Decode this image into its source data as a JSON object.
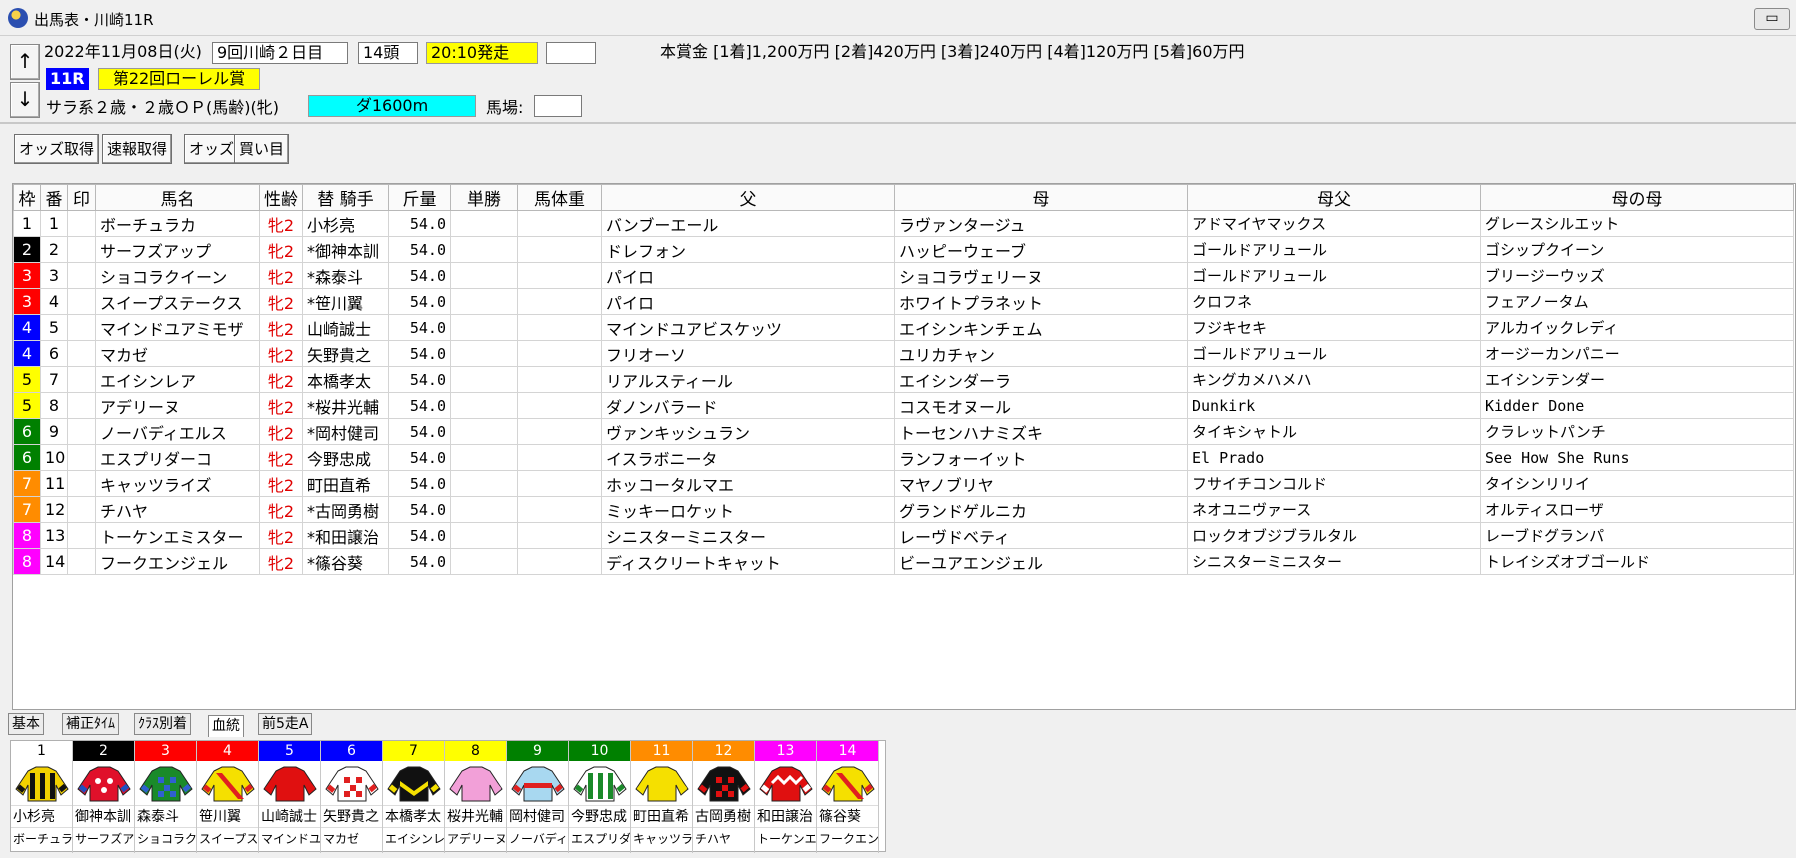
{
  "window": {
    "title": "出馬表・川崎11R",
    "restore_label": "▭"
  },
  "header": {
    "up_label": "↑",
    "down_label": "↓",
    "date": "2022年11月08日(火)",
    "meeting": "9回川崎２日目",
    "runners": "14頭",
    "post_time": "20:10発走",
    "blank_box": "",
    "prize": "本賞金 [1着]1,200万円 [2着]420万円 [3着]240万円 [4着]120万円 [5着]60万円",
    "race_no": "11R",
    "race_name": "第22回ローレル賞",
    "conditions": "サラ系２歳・２歳ＯＰ(馬齢)(牝)",
    "course": "ダ1600m",
    "baba_label": "馬場:",
    "baba_value": ""
  },
  "toolbar": {
    "odds_fetch": "オッズ取得",
    "sokuho_fetch": "速報取得",
    "odds": "オッズ",
    "kaime": "買い目"
  },
  "table": {
    "headers": [
      "枠",
      "番",
      "印",
      "馬名",
      "性齢",
      "替 騎手",
      "斤量",
      "単勝",
      "馬体重",
      "父",
      "母",
      "母父",
      "母の母"
    ],
    "rows": [
      {
        "waku": "1",
        "ban": "1",
        "mark": "",
        "name": "ボーチュラカ",
        "sex": "牝2",
        "jockey": " 小杉亮",
        "weight": "54.0",
        "odds": "",
        "bw": "",
        "sire": "バンブーエール",
        "dam": "ラヴァンタージュ",
        "damsire": "アドマイヤマックス",
        "damdam": "グレースシルエット"
      },
      {
        "waku": "2",
        "ban": "2",
        "mark": "",
        "name": "サーフズアップ",
        "sex": "牝2",
        "jockey": "*御神本訓",
        "weight": "54.0",
        "odds": "",
        "bw": "",
        "sire": "ドレフォン",
        "dam": "ハッピーウェーブ",
        "damsire": "ゴールドアリュール",
        "damdam": "ゴシップクイーン"
      },
      {
        "waku": "3",
        "ban": "3",
        "mark": "",
        "name": "ショコラクイーン",
        "sex": "牝2",
        "jockey": "*森泰斗",
        "weight": "54.0",
        "odds": "",
        "bw": "",
        "sire": "パイロ",
        "dam": "ショコラヴェリーヌ",
        "damsire": "ゴールドアリュール",
        "damdam": "ブリージーウッズ"
      },
      {
        "waku": "3",
        "ban": "4",
        "mark": "",
        "name": "スイープステークス",
        "sex": "牝2",
        "jockey": "*笹川翼",
        "weight": "54.0",
        "odds": "",
        "bw": "",
        "sire": "パイロ",
        "dam": "ホワイトプラネット",
        "damsire": "クロフネ",
        "damdam": "フェアノータム"
      },
      {
        "waku": "4",
        "ban": "5",
        "mark": "",
        "name": "マインドユアミモザ",
        "sex": "牝2",
        "jockey": " 山崎誠士",
        "weight": "54.0",
        "odds": "",
        "bw": "",
        "sire": "マインドユアビスケッツ",
        "dam": "エイシンキンチェム",
        "damsire": "フジキセキ",
        "damdam": "アルカイックレディ"
      },
      {
        "waku": "4",
        "ban": "6",
        "mark": "",
        "name": "マカゼ",
        "sex": "牝2",
        "jockey": " 矢野貴之",
        "weight": "54.0",
        "odds": "",
        "bw": "",
        "sire": "フリオーソ",
        "dam": "ユリカチャン",
        "damsire": "ゴールドアリュール",
        "damdam": "オージーカンパニー"
      },
      {
        "waku": "5",
        "ban": "7",
        "mark": "",
        "name": "エイシンレア",
        "sex": "牝2",
        "jockey": " 本橋孝太",
        "weight": "54.0",
        "odds": "",
        "bw": "",
        "sire": "リアルスティール",
        "dam": "エイシンダーラ",
        "damsire": "キングカメハメハ",
        "damdam": "エイシンテンダー"
      },
      {
        "waku": "5",
        "ban": "8",
        "mark": "",
        "name": "アデリーヌ",
        "sex": "牝2",
        "jockey": "*桜井光輔",
        "weight": "54.0",
        "odds": "",
        "bw": "",
        "sire": "ダノンバラード",
        "dam": "コスモオヌール",
        "damsire": "Dunkirk",
        "damdam": "Kidder Done"
      },
      {
        "waku": "6",
        "ban": "9",
        "mark": "",
        "name": "ノーバディエルス",
        "sex": "牝2",
        "jockey": "*岡村健司",
        "weight": "54.0",
        "odds": "",
        "bw": "",
        "sire": "ヴァンキッシュラン",
        "dam": "トーセンハナミズキ",
        "damsire": "タイキシャトル",
        "damdam": "クラレットパンチ"
      },
      {
        "waku": "6",
        "ban": "10",
        "mark": "",
        "name": "エスプリダーコ",
        "sex": "牝2",
        "jockey": " 今野忠成",
        "weight": "54.0",
        "odds": "",
        "bw": "",
        "sire": "イスラボニータ",
        "dam": "ランフォーイット",
        "damsire": "El Prado",
        "damdam": "See How She Runs"
      },
      {
        "waku": "7",
        "ban": "11",
        "mark": "",
        "name": "キャッツライズ",
        "sex": "牝2",
        "jockey": " 町田直希",
        "weight": "54.0",
        "odds": "",
        "bw": "",
        "sire": "ホッコータルマエ",
        "dam": "マヤノブリヤ",
        "damsire": "フサイチコンコルド",
        "damdam": "タイシンリリイ"
      },
      {
        "waku": "7",
        "ban": "12",
        "mark": "",
        "name": "チハヤ",
        "sex": "牝2",
        "jockey": "*古岡勇樹",
        "weight": "54.0",
        "odds": "",
        "bw": "",
        "sire": "ミッキーロケット",
        "dam": "グランドゲルニカ",
        "damsire": "ネオユニヴァース",
        "damdam": "オルティスローザ"
      },
      {
        "waku": "8",
        "ban": "13",
        "mark": "",
        "name": "トーケンエミスター",
        "sex": "牝2",
        "jockey": "*和田譲治",
        "weight": "54.0",
        "odds": "",
        "bw": "",
        "sire": "シニスターミニスター",
        "dam": "レーヴドベティ",
        "damsire": "ロックオブジブラルタル",
        "damdam": "レーブドグランパ"
      },
      {
        "waku": "8",
        "ban": "14",
        "mark": "",
        "name": "フークエンジェル",
        "sex": "牝2",
        "jockey": "*篠谷葵",
        "weight": "54.0",
        "odds": "",
        "bw": "",
        "sire": "ディスクリートキャット",
        "dam": "ビーユアエンジェル",
        "damsire": "シニスターミニスター",
        "damdam": "トレイシズオブゴールド"
      }
    ]
  },
  "tabs": [
    "基本",
    "補正ﾀｲﾑ",
    "ｸﾗｽ別着",
    "血統",
    "前5走A"
  ],
  "active_tab": "血統",
  "waku_colors": {
    "1": {
      "bg": "#ffffff",
      "fg": "#000000"
    },
    "2": {
      "bg": "#000000",
      "fg": "#ffffff"
    },
    "3": {
      "bg": "#ff0000",
      "fg": "#ffffff"
    },
    "4": {
      "bg": "#0000ff",
      "fg": "#ffffff"
    },
    "5": {
      "bg": "#ffff00",
      "fg": "#000000"
    },
    "6": {
      "bg": "#008000",
      "fg": "#ffffff"
    },
    "7": {
      "bg": "#ff8c00",
      "fg": "#ffffff"
    },
    "8": {
      "bg": "#ff00ff",
      "fg": "#ffffff"
    }
  },
  "silks": [
    {
      "num": "1",
      "jockey": "小杉亮",
      "horse": "ボーチュラ",
      "colors": [
        "#f2d100",
        "#111111"
      ],
      "icon": "silk-stripes-icon"
    },
    {
      "num": "2",
      "jockey": "御神本訓",
      "horse": "サーフズア",
      "colors": [
        "#e0102a",
        "#2050c0"
      ],
      "icon": "silk-stars-icon"
    },
    {
      "num": "3",
      "jockey": "森泰斗",
      "horse": "ショコラク",
      "colors": [
        "#1a8a2a",
        "#3060d0"
      ],
      "icon": "silk-check-icon"
    },
    {
      "num": "4",
      "jockey": "笹川翼",
      "horse": "スイープス",
      "colors": [
        "#f5e000",
        "#e02020"
      ],
      "icon": "silk-sash-icon"
    },
    {
      "num": "5",
      "jockey": "山崎誠士",
      "horse": "マインドユ",
      "colors": [
        "#e01010",
        "#e01010"
      ],
      "icon": "silk-plain-icon"
    },
    {
      "num": "6",
      "jockey": "矢野貴之",
      "horse": "マカゼ",
      "colors": [
        "#ffffff",
        "#e02020"
      ],
      "icon": "silk-diamond-icon"
    },
    {
      "num": "7",
      "jockey": "本橋孝太",
      "horse": "エイシンレ",
      "colors": [
        "#111111",
        "#f5e000"
      ],
      "icon": "silk-chevron-icon"
    },
    {
      "num": "8",
      "jockey": "桜井光輔",
      "horse": "アデリーヌ",
      "colors": [
        "#f2a0d8",
        "#f2a0d8"
      ],
      "icon": "silk-plain-icon"
    },
    {
      "num": "9",
      "jockey": "岡村健司",
      "horse": "ノーバディ",
      "colors": [
        "#a8d8f0",
        "#e02020"
      ],
      "icon": "silk-band-icon"
    },
    {
      "num": "10",
      "jockey": "今野忠成",
      "horse": "エスプリダ",
      "colors": [
        "#ffffff",
        "#1a8a2a"
      ],
      "icon": "silk-stripes-icon"
    },
    {
      "num": "11",
      "jockey": "町田直希",
      "horse": "キャッツラ",
      "colors": [
        "#f5e000",
        "#f5e000"
      ],
      "icon": "silk-plain-icon"
    },
    {
      "num": "12",
      "jockey": "古岡勇樹",
      "horse": "チハヤ",
      "colors": [
        "#111111",
        "#e01010"
      ],
      "icon": "silk-check-icon"
    },
    {
      "num": "13",
      "jockey": "和田譲治",
      "horse": "トーケンエ",
      "colors": [
        "#e01010",
        "#ffffff"
      ],
      "icon": "silk-zigzag-icon"
    },
    {
      "num": "14",
      "jockey": "篠谷葵",
      "horse": "フークエン",
      "colors": [
        "#f5e000",
        "#e02020"
      ],
      "icon": "silk-sash-icon"
    }
  ]
}
